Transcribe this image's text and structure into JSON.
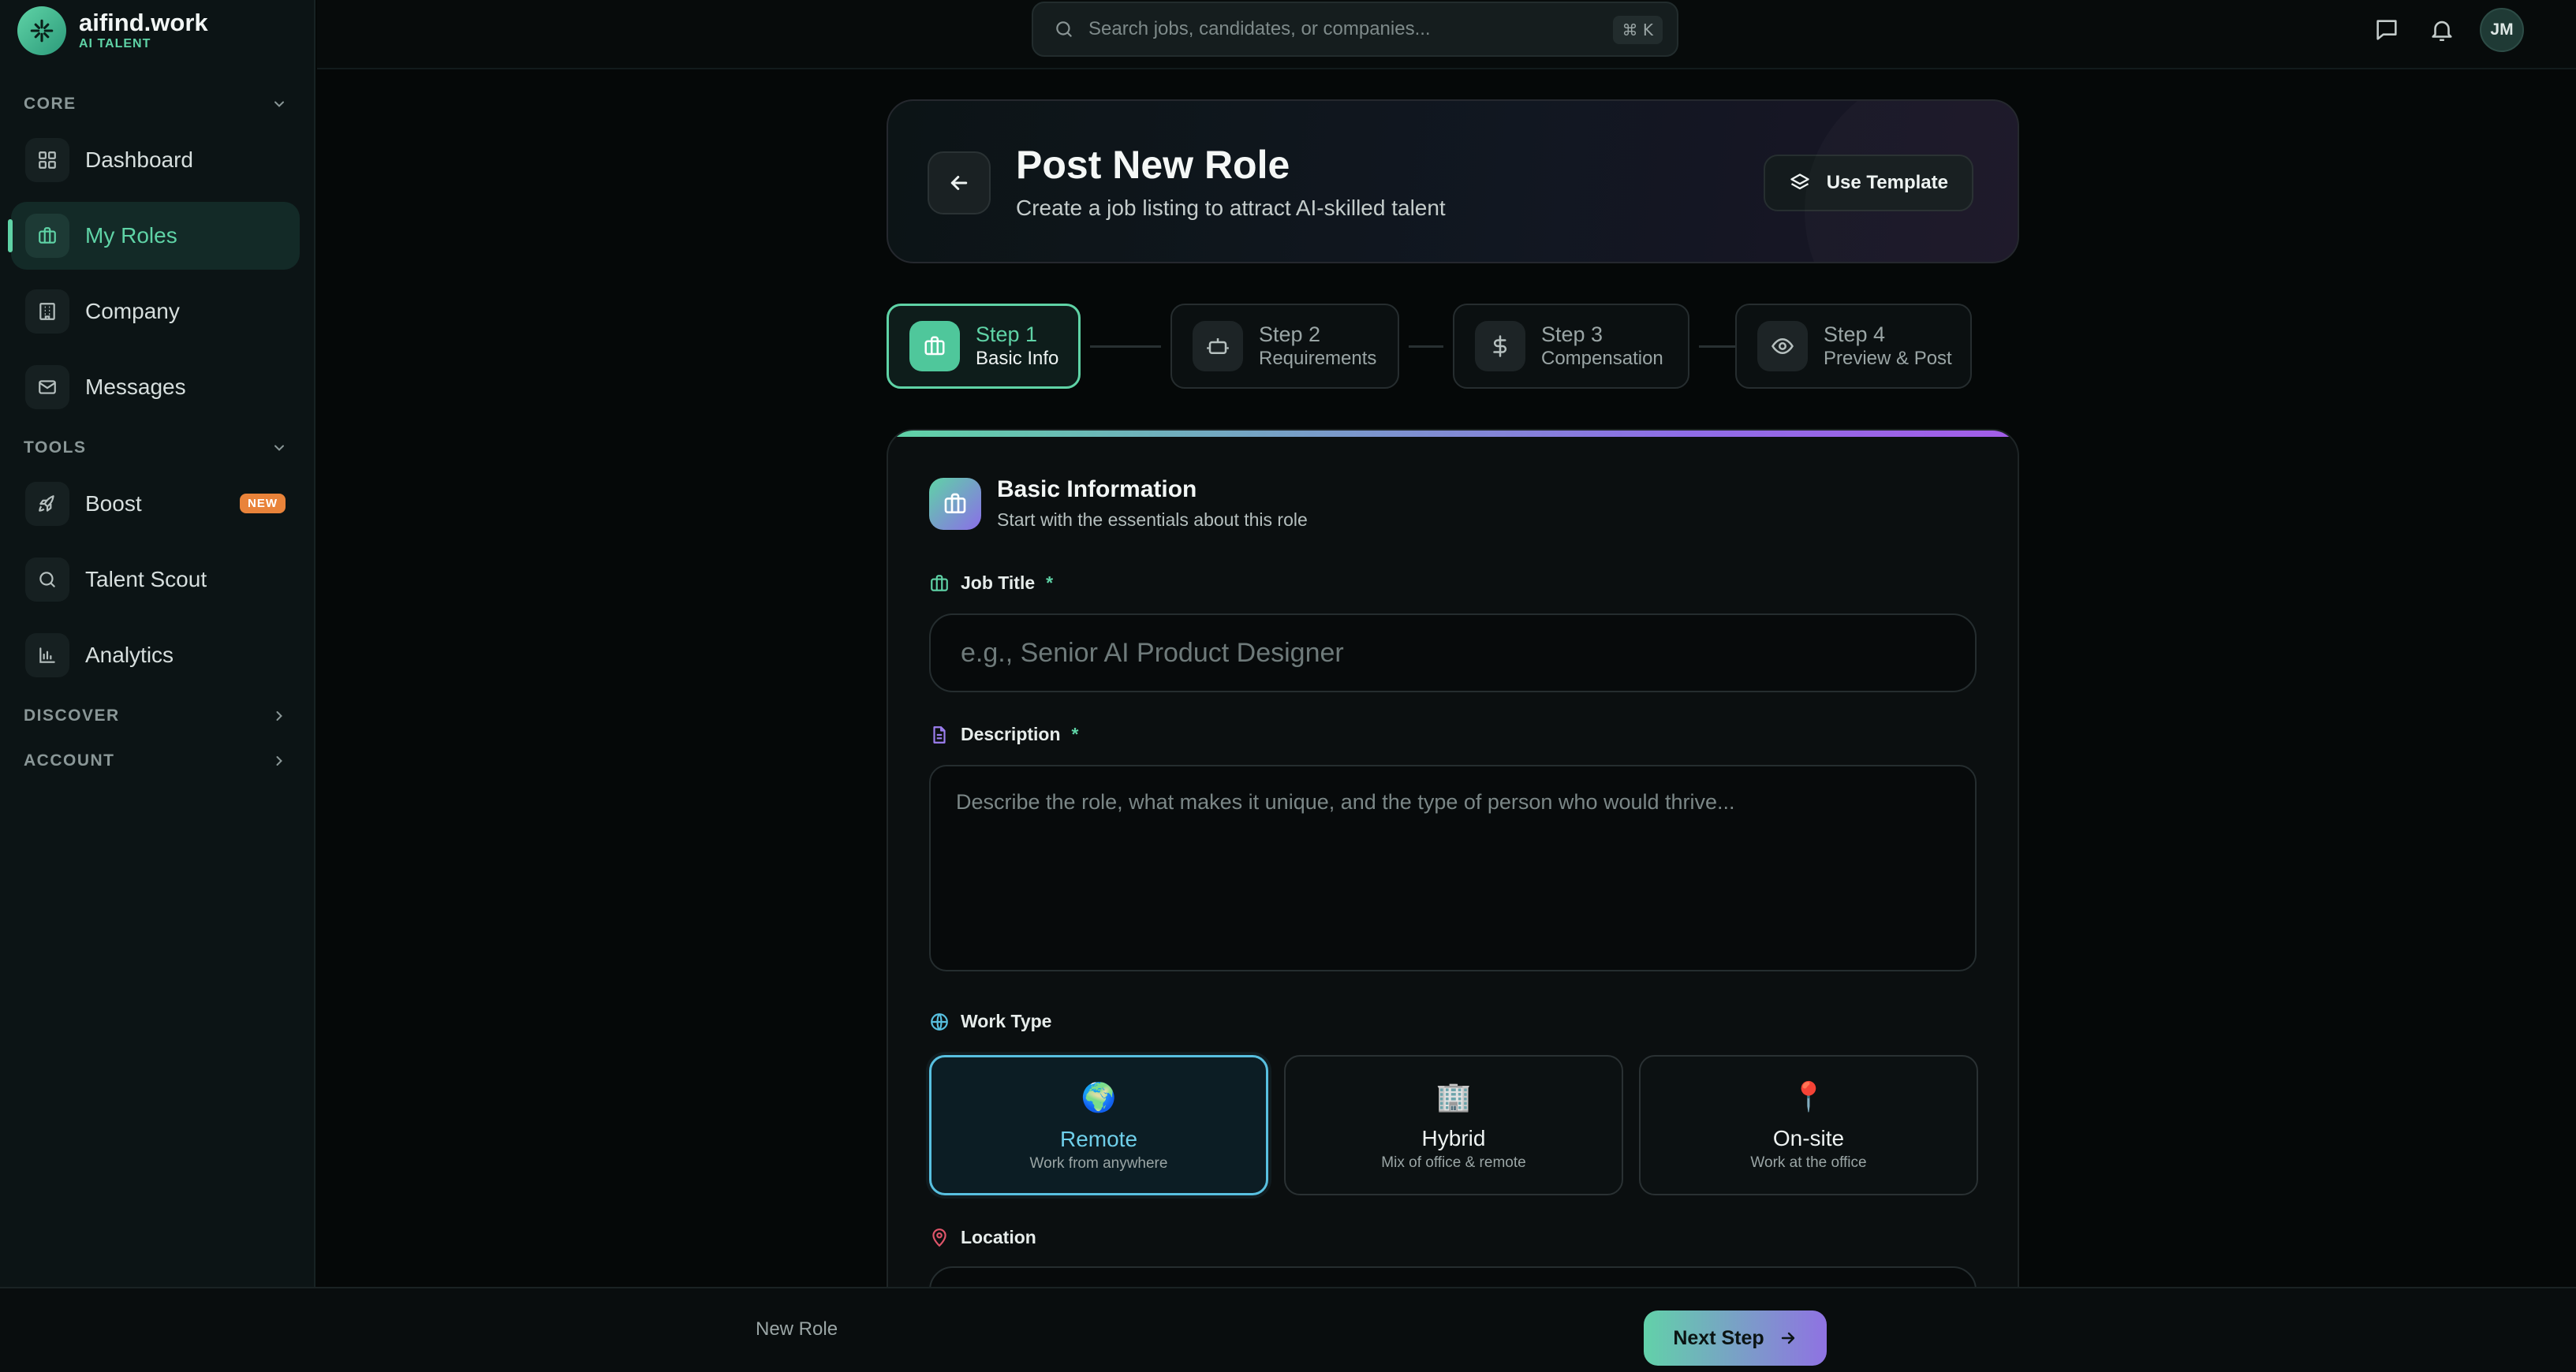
{
  "brand": {
    "name": "aifind.work",
    "subtitle": "AI TALENT"
  },
  "sidebar": {
    "sections": [
      {
        "label": "CORE",
        "expanded": true,
        "items": [
          {
            "label": "Dashboard",
            "icon": "grid-icon"
          },
          {
            "label": "My Roles",
            "icon": "briefcase-icon",
            "active": true
          },
          {
            "label": "Company",
            "icon": "building-icon"
          },
          {
            "label": "Messages",
            "icon": "mail-icon"
          }
        ]
      },
      {
        "label": "TOOLS",
        "expanded": true,
        "items": [
          {
            "label": "Boost",
            "icon": "rocket-icon",
            "badge": "NEW"
          },
          {
            "label": "Talent Scout",
            "icon": "search-icon"
          },
          {
            "label": "Analytics",
            "icon": "bar-chart-icon"
          }
        ]
      },
      {
        "label": "DISCOVER",
        "expanded": false,
        "items": []
      },
      {
        "label": "ACCOUNT",
        "expanded": false,
        "items": []
      }
    ]
  },
  "topbar": {
    "search_placeholder": "Search jobs, candidates, or companies...",
    "shortcut": "⌘ K",
    "avatar_initials": "JM"
  },
  "header": {
    "title": "Post New Role",
    "subtitle": "Create a job listing to attract AI-skilled talent",
    "template_button": "Use Template"
  },
  "steps": [
    {
      "name": "Step 1",
      "desc": "Basic Info",
      "active": true,
      "icon": "briefcase-icon"
    },
    {
      "name": "Step 2",
      "desc": "Requirements",
      "active": false,
      "icon": "robot-icon"
    },
    {
      "name": "Step 3",
      "desc": "Compensation",
      "active": false,
      "icon": "dollar-icon"
    },
    {
      "name": "Step 4",
      "desc": "Preview & Post",
      "active": false,
      "icon": "eye-icon"
    }
  ],
  "form": {
    "section_title": "Basic Information",
    "section_subtitle": "Start with the essentials about this role",
    "job_title": {
      "label": "Job Title",
      "required_mark": "*",
      "placeholder": "e.g., Senior AI Product Designer",
      "value": ""
    },
    "description": {
      "label": "Description",
      "required_mark": "*",
      "placeholder": "Describe the role, what makes it unique, and the type of person who would thrive...",
      "value": ""
    },
    "work_type": {
      "label": "Work Type",
      "selected": "Remote",
      "options": [
        {
          "emoji": "🌍",
          "name": "Remote",
          "desc": "Work from anywhere"
        },
        {
          "emoji": "🏢",
          "name": "Hybrid",
          "desc": "Mix of office & remote"
        },
        {
          "emoji": "📍",
          "name": "On-site",
          "desc": "Work at the office"
        }
      ]
    },
    "location": {
      "label": "Location"
    }
  },
  "bottombar": {
    "label": "New Role",
    "next_button": "Next Step"
  },
  "colors": {
    "accent": "#5fd3a6",
    "accent_purple": "#8e6de6",
    "selected_blue": "#58c0e0",
    "badge_orange": "#e9833a"
  }
}
